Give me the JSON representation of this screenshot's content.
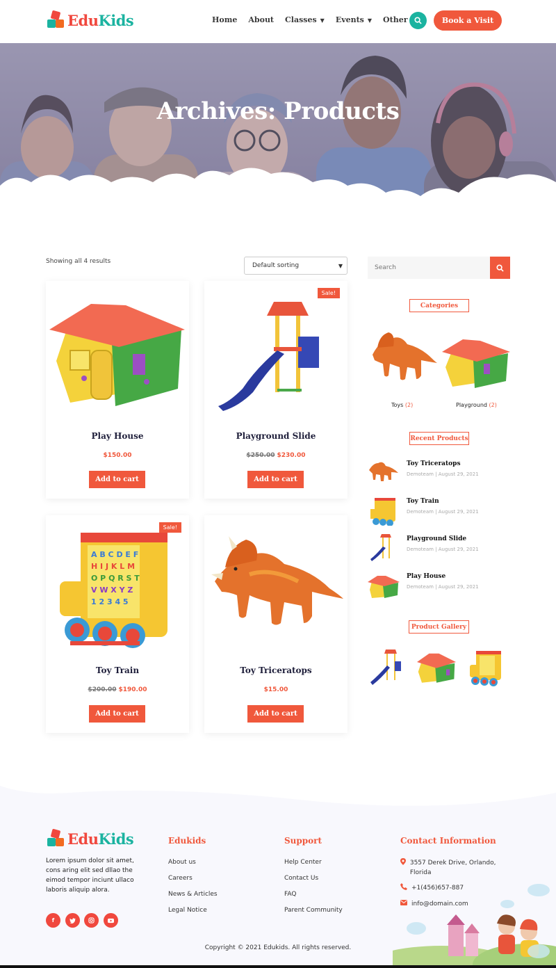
{
  "brand": {
    "name_part1": "Edu",
    "name_part2": "Kids"
  },
  "nav": {
    "items": [
      {
        "label": "Home",
        "dropdown": false
      },
      {
        "label": "About",
        "dropdown": false
      },
      {
        "label": "Classes",
        "dropdown": true
      },
      {
        "label": "Events",
        "dropdown": true
      },
      {
        "label": "Other",
        "dropdown": true
      }
    ],
    "cta": "Book a Visit"
  },
  "hero": {
    "title": "Archives: Products"
  },
  "shop": {
    "results_text": "Showing all 4 results",
    "sorting": "Default sorting",
    "products": [
      {
        "name": "Play House",
        "price": "$150.00",
        "old_price": "",
        "sale": false,
        "cart_label": "Add to cart"
      },
      {
        "name": "Playground Slide",
        "price": "$230.00",
        "old_price": "$250.00",
        "sale": true,
        "sale_label": "Sale!",
        "cart_label": "Add to cart"
      },
      {
        "name": "Toy Train",
        "price": "$190.00",
        "old_price": "$200.00",
        "sale": true,
        "sale_label": "Sale!",
        "cart_label": "Add to cart"
      },
      {
        "name": "Toy Triceratops",
        "price": "$15.00",
        "old_price": "",
        "sale": false,
        "cart_label": "Add to cart"
      }
    ]
  },
  "sidebar": {
    "search_placeholder": "Search",
    "categories_title": "Categories",
    "categories": [
      {
        "name": "Toys",
        "count": "(2)"
      },
      {
        "name": "Playground",
        "count": "(2)"
      }
    ],
    "recent_title": "Recent Products",
    "recent": [
      {
        "title": "Toy Triceratops",
        "meta": "Demoteam | August 29, 2021"
      },
      {
        "title": "Toy Train",
        "meta": "Demoteam | August 29, 2021"
      },
      {
        "title": "Playground Slide",
        "meta": "Demoteam | August 29, 2021"
      },
      {
        "title": "Play House",
        "meta": "Demoteam | August 29, 2021"
      }
    ],
    "gallery_title": "Product Gallery"
  },
  "footer": {
    "description": "Lorem ipsum dolor sit amet, cons aring elit sed dllao the eimod tempor inciunt ullaco laboris aliquip alora.",
    "col1_title": "Edukids",
    "col1_links": [
      "About us",
      "Careers",
      "News & Articles",
      "Legal Notice"
    ],
    "col2_title": "Support",
    "col2_links": [
      "Help Center",
      "Contact Us",
      "FAQ",
      "Parent Community"
    ],
    "col3_title": "Contact Information",
    "address": "3557 Derek Drive, Orlando, Florida",
    "phone": "+1(456)657-887",
    "email": "info@domain.com",
    "social": [
      "f",
      "t",
      "ig",
      "yt"
    ],
    "copyright": "Copyright © 2021 Edukids. All rights reserved."
  },
  "colors": {
    "accent": "#f0583c",
    "teal": "#1bb3a0",
    "navy": "#1e1e3a"
  }
}
